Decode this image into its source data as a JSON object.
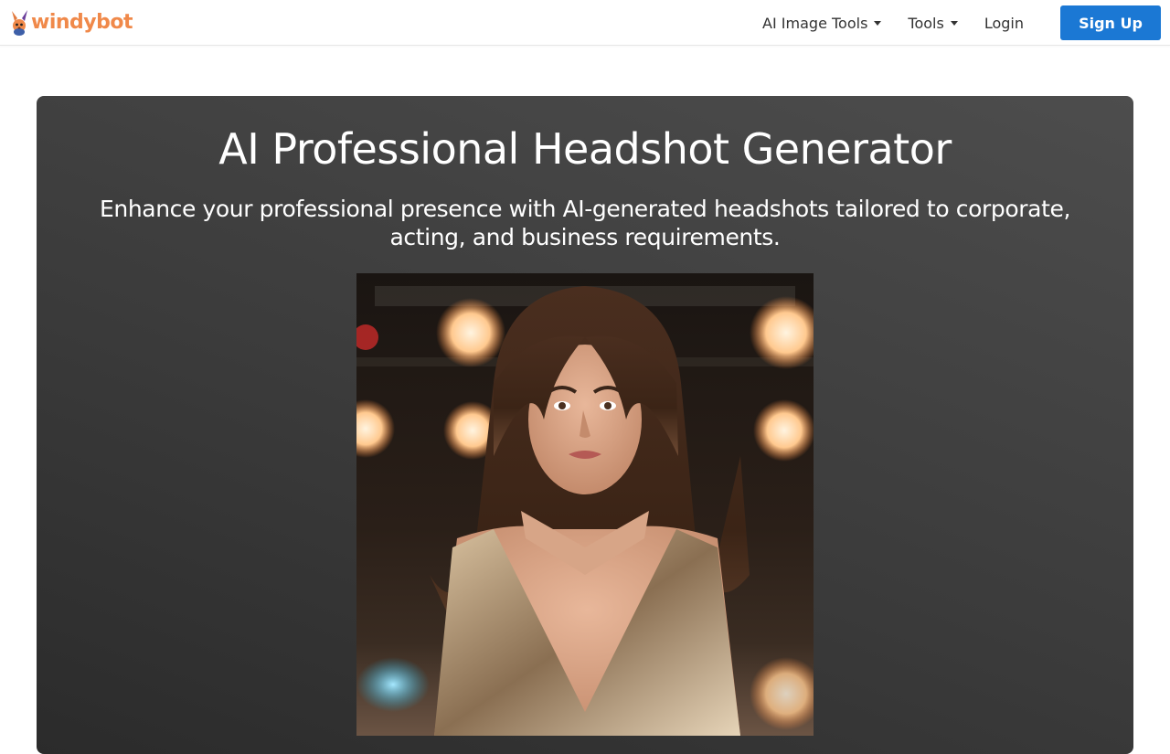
{
  "header": {
    "brand": "windybot",
    "nav": [
      {
        "label": "AI Image Tools",
        "dropdown": true
      },
      {
        "label": "Tools",
        "dropdown": true
      },
      {
        "label": "Login",
        "dropdown": false
      }
    ],
    "signup_label": "Sign Up"
  },
  "hero": {
    "title": "AI Professional Headshot Generator",
    "subtitle": "Enhance your professional presence with AI-generated headshots tailored to corporate, acting, and business requirements."
  },
  "colors": {
    "brand": "#f0894a",
    "primary": "#1b78d4",
    "nav_text": "#333333",
    "hero_text": "#ffffff"
  },
  "icons": {
    "logo": "rabbit-logo-icon",
    "dropdown": "caret-down-icon"
  }
}
